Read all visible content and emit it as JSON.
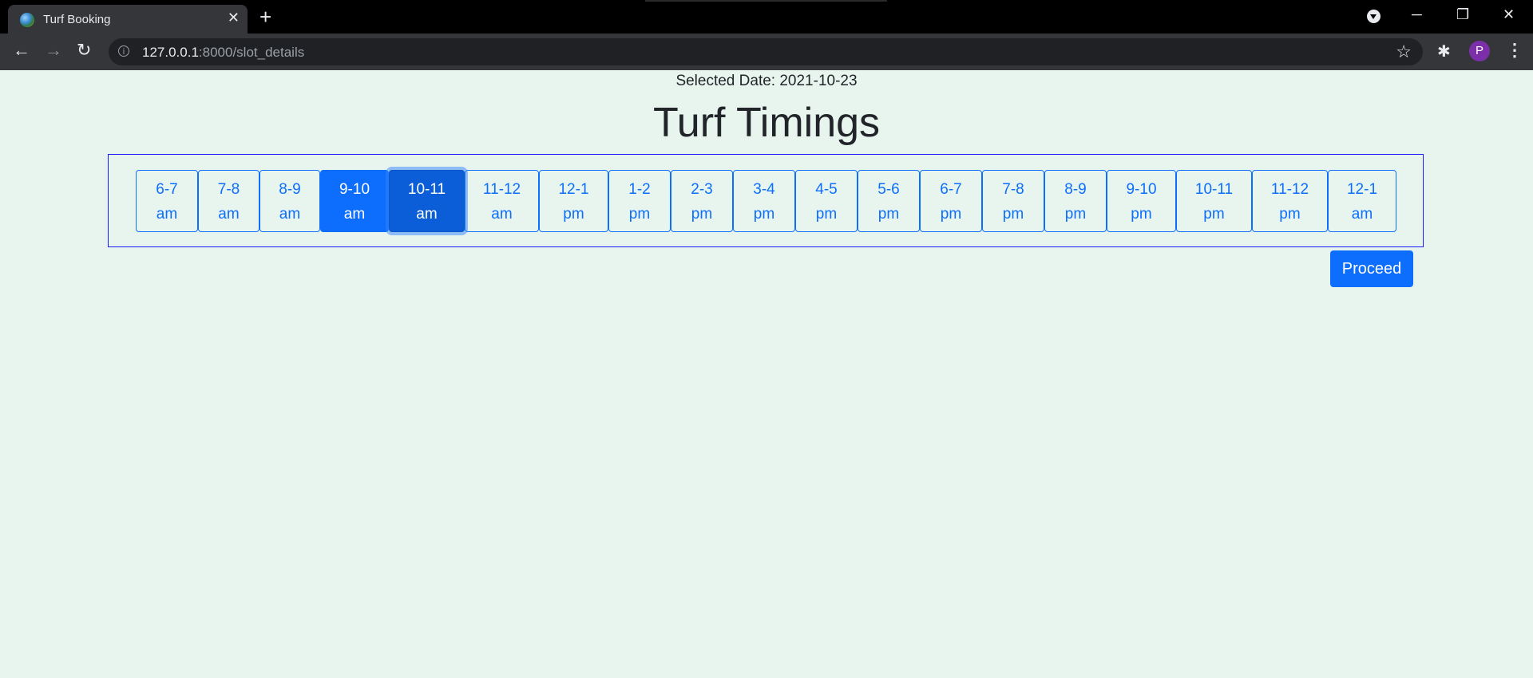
{
  "browser": {
    "tab_title": "Turf Booking",
    "tab_close": "✕",
    "new_tab": "+",
    "url_host": "127.0.0.1",
    "url_rest": ":8000/slot_details",
    "profile_initial": "P",
    "icons": [
      "favicon-icon",
      "close-icon",
      "plus-icon",
      "back-icon",
      "forward-icon",
      "reload-icon",
      "info-icon",
      "star-icon",
      "extensions-icon",
      "kebab-menu-icon",
      "minimize-icon",
      "restore-icon",
      "window-close-icon"
    ]
  },
  "page": {
    "selected_date_label": "Selected Date: 2021-10-23",
    "title": "Turf Timings",
    "proceed_label": "Proceed",
    "accent_color": "#0d6efd",
    "background_color": "#e8f5ee"
  },
  "slots": [
    {
      "range": "6-7",
      "period": "am",
      "state": "default"
    },
    {
      "range": "7-8",
      "period": "am",
      "state": "default"
    },
    {
      "range": "8-9",
      "period": "am",
      "state": "default"
    },
    {
      "range": "9-10",
      "period": "am",
      "state": "selected"
    },
    {
      "range": "10-11",
      "period": "am",
      "state": "selected-focused"
    },
    {
      "range": "11-12",
      "period": "am",
      "state": "default"
    },
    {
      "range": "12-1",
      "period": "pm",
      "state": "default"
    },
    {
      "range": "1-2",
      "period": "pm",
      "state": "default"
    },
    {
      "range": "2-3",
      "period": "pm",
      "state": "default"
    },
    {
      "range": "3-4",
      "period": "pm",
      "state": "default"
    },
    {
      "range": "4-5",
      "period": "pm",
      "state": "default"
    },
    {
      "range": "5-6",
      "period": "pm",
      "state": "default"
    },
    {
      "range": "6-7",
      "period": "pm",
      "state": "default"
    },
    {
      "range": "7-8",
      "period": "pm",
      "state": "default"
    },
    {
      "range": "8-9",
      "period": "pm",
      "state": "default"
    },
    {
      "range": "9-10",
      "period": "pm",
      "state": "default"
    },
    {
      "range": "10-11",
      "period": "pm",
      "state": "default"
    },
    {
      "range": "11-12",
      "period": "pm",
      "state": "default"
    },
    {
      "range": "12-1",
      "period": "am",
      "state": "default"
    }
  ]
}
